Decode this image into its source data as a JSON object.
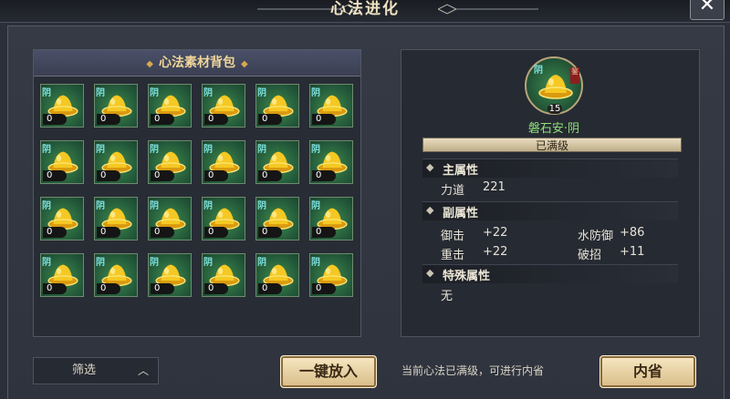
{
  "window": {
    "title": "心法进化",
    "close_icon": "close-icon"
  },
  "bag": {
    "title": "心法素材背包",
    "slot_tag": "阴",
    "slots": [
      {
        "count": "0"
      },
      {
        "count": "0"
      },
      {
        "count": "0"
      },
      {
        "count": "0"
      },
      {
        "count": "0"
      },
      {
        "count": "0"
      },
      {
        "count": "0"
      },
      {
        "count": "0"
      },
      {
        "count": "0"
      },
      {
        "count": "0"
      },
      {
        "count": "0"
      },
      {
        "count": "0"
      },
      {
        "count": "0"
      },
      {
        "count": "0"
      },
      {
        "count": "0"
      },
      {
        "count": "0"
      },
      {
        "count": "0"
      },
      {
        "count": "0"
      },
      {
        "count": "0"
      },
      {
        "count": "0"
      },
      {
        "count": "0"
      },
      {
        "count": "0"
      },
      {
        "count": "0"
      },
      {
        "count": "0"
      }
    ]
  },
  "filter": {
    "label": "筛选",
    "icon": "chevron-up-icon"
  },
  "actions": {
    "one_click": "一键放入",
    "hint": "当前心法已满级，可进行内省",
    "inner": "内省"
  },
  "detail": {
    "icon_tag": "阴",
    "icon_seal": "鉴",
    "level": "15",
    "name": "磐石安·阴",
    "status": "已满级",
    "main_attr": {
      "title": "主属性",
      "rows": [
        {
          "label": "力道",
          "value": "221"
        }
      ]
    },
    "sub_attr": {
      "title": "副属性",
      "rows": [
        {
          "label": "御击",
          "value": "+22"
        },
        {
          "label": "水防御",
          "value": "+86"
        },
        {
          "label": "重击",
          "value": "+22"
        },
        {
          "label": "破招",
          "value": "+11"
        }
      ]
    },
    "special_attr": {
      "title": "特殊属性",
      "value": "无"
    }
  },
  "colors": {
    "accent_gold": "#f0d69a",
    "item_name": "#8fe27a",
    "slot_bg": "#23593a"
  }
}
